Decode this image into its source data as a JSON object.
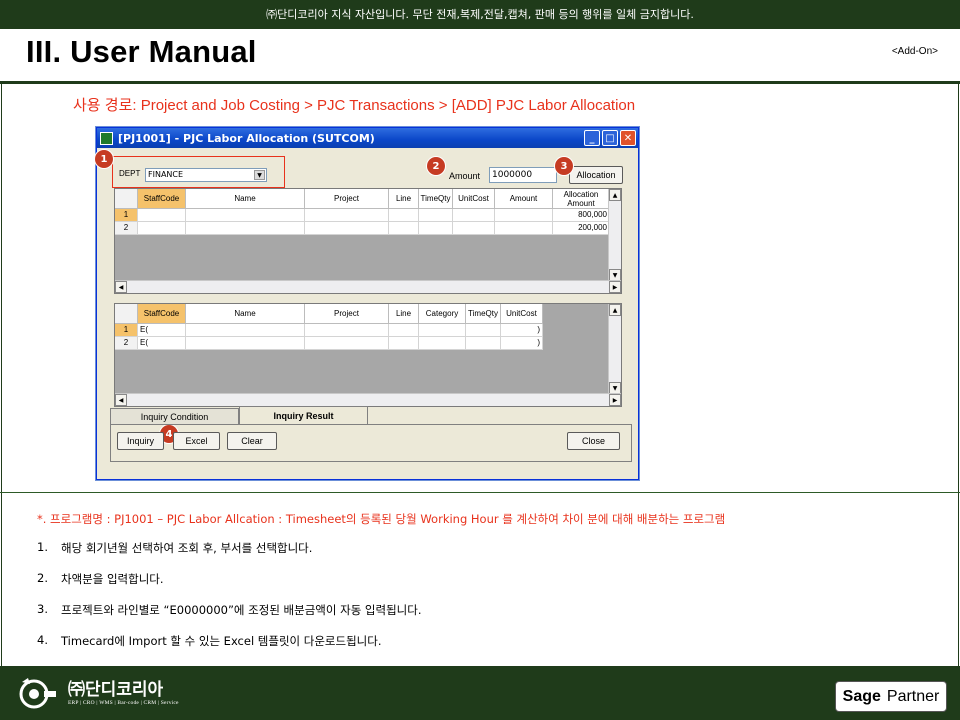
{
  "banner": "㈜단디코리아 지식 자산입니다. 무단 전재,복제,전달,캡쳐, 판매 등의 행위를 일체 금지합니다.",
  "header": {
    "title": "III. User Manual",
    "addon": "<Add-On>"
  },
  "path": "사용 경로: Project and Job Costing > PJC Transactions > [ADD] PJC Labor Allocation",
  "window": {
    "title": "[PJ1001] - PJC Labor Allocation (SUTCOM)",
    "dept_label": "DEPT",
    "dept_value": "FINANCE",
    "amount_label": "Amount",
    "amount_value": "1000000",
    "allocation_button": "Allocation",
    "grid1": {
      "columns": [
        "StaffCode",
        "Name",
        "Project",
        "Line",
        "TimeQty",
        "UnitCost",
        "Amount",
        "Allocation Amount"
      ],
      "rows": [
        {
          "no": "1",
          "allocation": "800,000"
        },
        {
          "no": "2",
          "allocation": "200,000"
        }
      ]
    },
    "grid2": {
      "columns": [
        "StaffCode",
        "Name",
        "Project",
        "Line",
        "Category",
        "TimeQty",
        "UnitCost"
      ],
      "rows": [
        {
          "no": "1",
          "staff": "E(",
          "end": ")"
        },
        {
          "no": "2",
          "staff": "E(",
          "end": ")"
        }
      ]
    },
    "tabs": [
      "Inquiry Condition",
      "Inquiry Result"
    ],
    "buttons": {
      "inquiry": "Inquiry",
      "excel": "Excel",
      "clear": "Clear",
      "close": "Close"
    },
    "badges": [
      "1",
      "2",
      "3",
      "4"
    ],
    "titlebar_buttons": [
      "_",
      "□",
      "✕"
    ]
  },
  "program_desc": "*. 프로그램명 : PJ1001 – PJC Labor Allcation : Timesheet의 등록된 당월 Working Hour 를 계산하여 차이 분에 대해 배분하는 프로그램",
  "steps": [
    {
      "num": "1.",
      "text": "해당 회기년월 선택하여 조회 후, 부서를 선택합니다."
    },
    {
      "num": "2.",
      "text": "차액분을 입력합니다."
    },
    {
      "num": "3.",
      "text": "프로젝트와 라인별로 “E0000000”에 조정된 배분금액이 자동 입력됩니다."
    },
    {
      "num": "4.",
      "text": "Timecard에 Import 할 수 있는 Excel 템플릿이 다운로드됩니다."
    }
  ],
  "footer": {
    "logo_name": "㈜단디코리아",
    "logo_sub": "ERP | CRO | WMS | Bar-code | CRM | Service",
    "partner_brand": "Sage",
    "partner_label": "Partner"
  },
  "colors": {
    "dark_green": "#1f3b1a",
    "accent_red": "#e8321c",
    "badge": "#c63b22",
    "selected_header": "#f5c26b"
  }
}
